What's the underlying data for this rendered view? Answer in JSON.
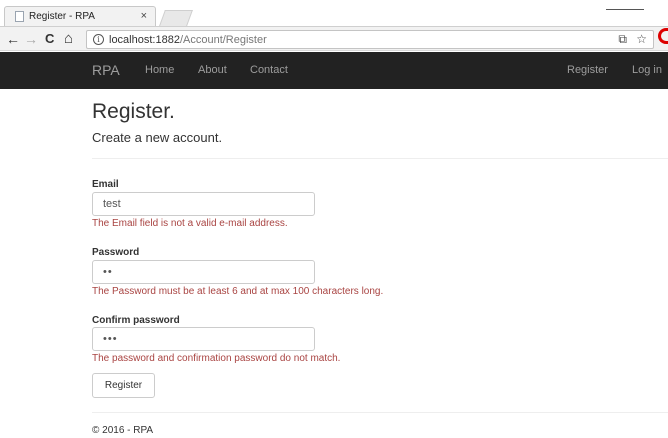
{
  "browser": {
    "tab_title": "Register - RPA",
    "tab_close": "×",
    "url_host": "localhost:1882",
    "url_path": "/Account/Register",
    "back": "←",
    "forward": "→",
    "reload": "C",
    "home": "⌂",
    "info": "i",
    "translate": "⧉",
    "star": "☆"
  },
  "navbar": {
    "brand": "RPA",
    "links": [
      "Home",
      "About",
      "Contact"
    ],
    "right_links": [
      "Register",
      "Log in"
    ]
  },
  "page": {
    "title": "Register.",
    "subtitle": "Create a new account."
  },
  "form": {
    "email": {
      "label": "Email",
      "value": "test",
      "error": "The Email field is not a valid e-mail address."
    },
    "password": {
      "label": "Password",
      "value": "••",
      "error": "The Password must be at least 6 and at max 100 characters long."
    },
    "confirm": {
      "label": "Confirm password",
      "value": "•••",
      "error": "The password and confirmation password do not match."
    },
    "submit_label": "Register"
  },
  "footer": {
    "text": "© 2016 - RPA"
  }
}
